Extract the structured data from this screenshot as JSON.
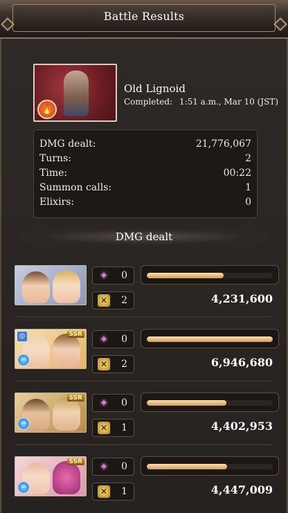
{
  "header": {
    "title": "Battle Results"
  },
  "boss": {
    "name": "Old Lignoid",
    "completed_label": "Completed:",
    "completed_value": "1:51 a.m., Mar 10 (JST)",
    "element": "fire",
    "element_icon": "flame-icon"
  },
  "stats": [
    {
      "label": "DMG dealt:",
      "value": "21,776,067"
    },
    {
      "label": "Turns:",
      "value": "2"
    },
    {
      "label": "Time:",
      "value": "00:22"
    },
    {
      "label": "Summon calls:",
      "value": "1"
    },
    {
      "label": "Elixirs:",
      "value": "0"
    }
  ],
  "section": {
    "title": "DMG dealt"
  },
  "party": [
    {
      "sparkles": "0",
      "charge_attacks": "2",
      "damage": "4,231,600",
      "bar_fraction": 0.61,
      "ssr": "",
      "element": "",
      "ring": ""
    },
    {
      "sparkles": "0",
      "charge_attacks": "2",
      "damage": "6,946,680",
      "bar_fraction": 1.0,
      "ssr": "SSR",
      "element": "wind",
      "ring": "ring"
    },
    {
      "sparkles": "0",
      "charge_attacks": "1",
      "damage": "4,402,953",
      "bar_fraction": 0.63,
      "ssr": "SSR",
      "element": "wind",
      "ring": ""
    },
    {
      "sparkles": "0",
      "charge_attacks": "1",
      "damage": "4,447,009",
      "bar_fraction": 0.64,
      "ssr": "SSR",
      "element": "wind",
      "ring": ""
    }
  ],
  "icons": {
    "sparkle": "sparkle-icon",
    "charge_attack": "charge-attack-icon"
  },
  "colors": {
    "bar_fill": "#e0a862",
    "boss_bg": "#8a2a30",
    "element_wind": "#1e6fd0"
  }
}
